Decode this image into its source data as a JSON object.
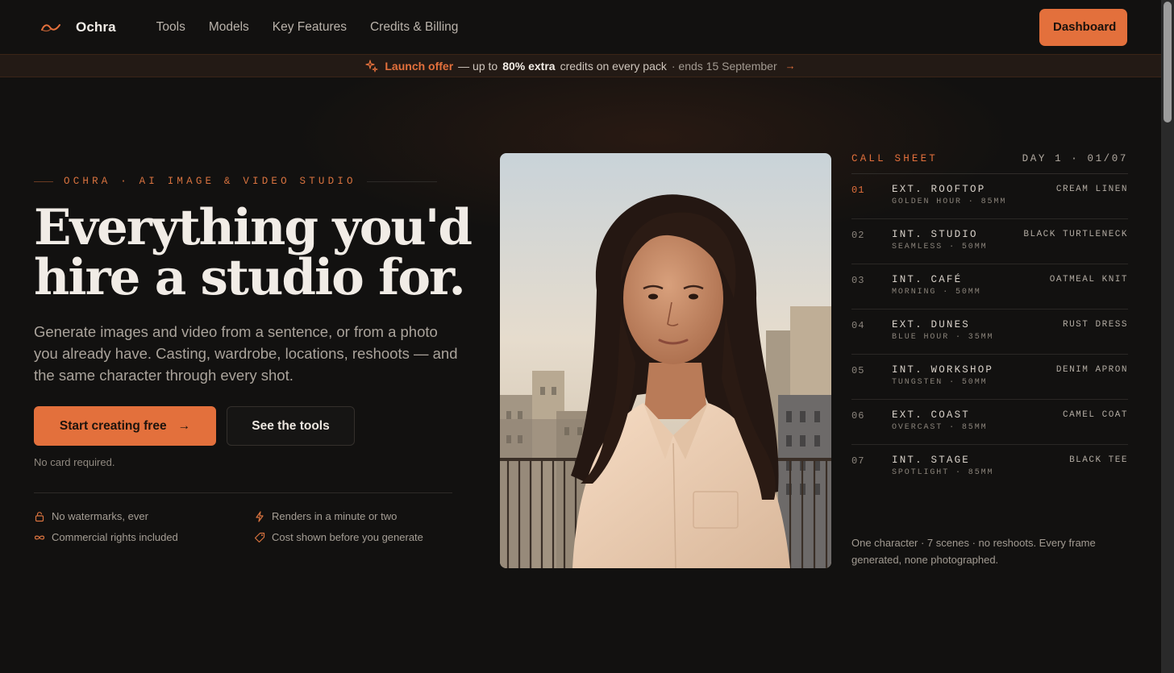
{
  "nav": {
    "brand": "Ochra",
    "links": [
      "Tools",
      "Models",
      "Key Features",
      "Credits & Billing"
    ],
    "dashboard_label": "Dashboard"
  },
  "banner": {
    "offer": "Launch offer",
    "text1": "— up to",
    "strong": "80% extra",
    "text2": "credits on every pack",
    "ends": "· ends 15 September"
  },
  "hero": {
    "eyebrow": "OCHRA · AI IMAGE & VIDEO STUDIO",
    "headline_line1": "Everything you'd",
    "headline_line2": "hire a studio for.",
    "subtitle": "Generate images and video from a sentence, or from a photo you already have. Casting, wardrobe, locations, reshoots — and the same character through every shot.",
    "cta_primary": "Start creating free",
    "cta_secondary": "See the tools",
    "no_card": "No card required.",
    "features": [
      {
        "icon": "lock-icon",
        "text": "No watermarks, ever"
      },
      {
        "icon": "bolt-icon",
        "text": "Renders in a minute or two"
      },
      {
        "icon": "infinity-icon",
        "text": "Commercial rights included"
      },
      {
        "icon": "tag-icon",
        "text": "Cost shown before you generate"
      }
    ]
  },
  "call_sheet": {
    "title": "CALL SHEET",
    "day": "DAY 1 · 01/07",
    "rows": [
      {
        "num": "01",
        "scene": "EXT. ROOFTOP",
        "detail": "GOLDEN HOUR · 85MM",
        "wardrobe": "CREAM LINEN"
      },
      {
        "num": "02",
        "scene": "INT. STUDIO",
        "detail": "SEAMLESS · 50MM",
        "wardrobe": "BLACK TURTLENECK"
      },
      {
        "num": "03",
        "scene": "INT. CAFÉ",
        "detail": "MORNING · 50MM",
        "wardrobe": "OATMEAL KNIT"
      },
      {
        "num": "04",
        "scene": "EXT. DUNES",
        "detail": "BLUE HOUR · 35MM",
        "wardrobe": "RUST DRESS"
      },
      {
        "num": "05",
        "scene": "INT. WORKSHOP",
        "detail": "TUNGSTEN · 50MM",
        "wardrobe": "DENIM APRON"
      },
      {
        "num": "06",
        "scene": "EXT. COAST",
        "detail": "OVERCAST · 85MM",
        "wardrobe": "CAMEL COAT"
      },
      {
        "num": "07",
        "scene": "INT. STAGE",
        "detail": "SPOTLIGHT · 85MM",
        "wardrobe": "BLACK TEE"
      }
    ],
    "note": "One character · 7 scenes · no reshoots. Every frame generated, none photographed."
  },
  "colors": {
    "accent": "#e3703c",
    "background": "#121110",
    "banner_bg": "#231a15",
    "text": "#e9e3dc"
  }
}
